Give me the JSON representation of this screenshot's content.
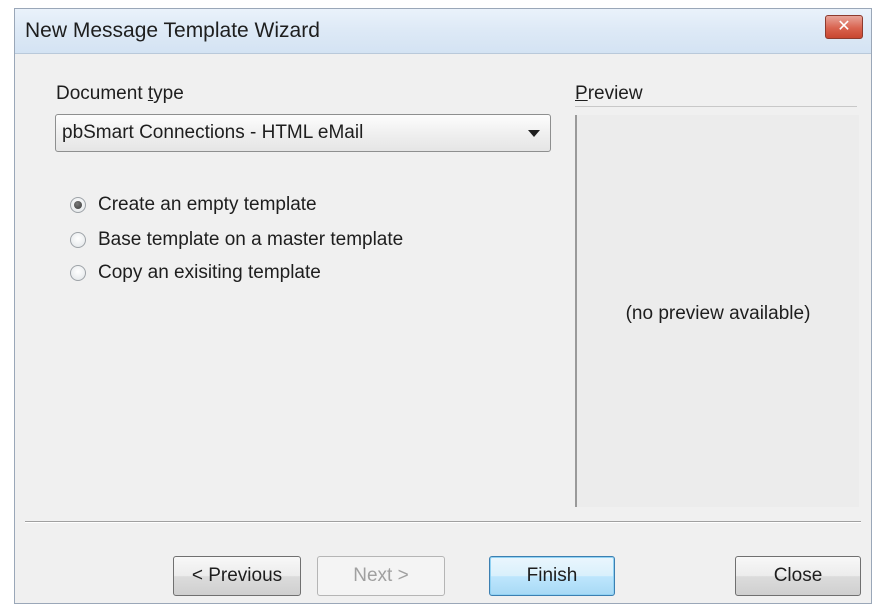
{
  "window": {
    "title": "New Message Template Wizard",
    "close_symbol": "✕"
  },
  "document_type": {
    "label_prefix": "Document ",
    "label_access_key": "t",
    "label_suffix": "ype",
    "selected": "pbSmart Connections - HTML eMail"
  },
  "options": [
    {
      "label": "Create an empty template",
      "checked": true
    },
    {
      "label": "Base template on a master template",
      "checked": false
    },
    {
      "label": "Copy an exisiting  template",
      "checked": false
    }
  ],
  "preview": {
    "label_access_key": "P",
    "label_suffix": "review",
    "empty_text": "(no preview available)"
  },
  "buttons": {
    "previous": "< Previous",
    "next": "Next >",
    "finish": "Finish",
    "close": "Close"
  }
}
